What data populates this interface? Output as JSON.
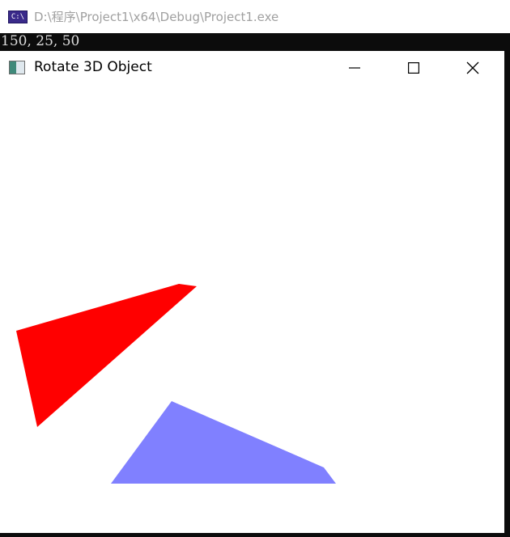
{
  "console_window": {
    "title": "D:\\程序\\Project1\\x64\\Debug\\Project1.exe",
    "icon": "console-app-icon",
    "icon_text": "C:\\",
    "output_line": "150, 25, 50"
  },
  "gl_window": {
    "title": "Rotate 3D Object",
    "icon": "window-app-icon",
    "buttons": {
      "minimize": "minimize-icon",
      "maximize": "maximize-icon",
      "close": "close-icon"
    },
    "colors": {
      "red_triangle": "#ff0000",
      "blue_triangle": "#8080ff",
      "background": "#ffffff"
    }
  }
}
